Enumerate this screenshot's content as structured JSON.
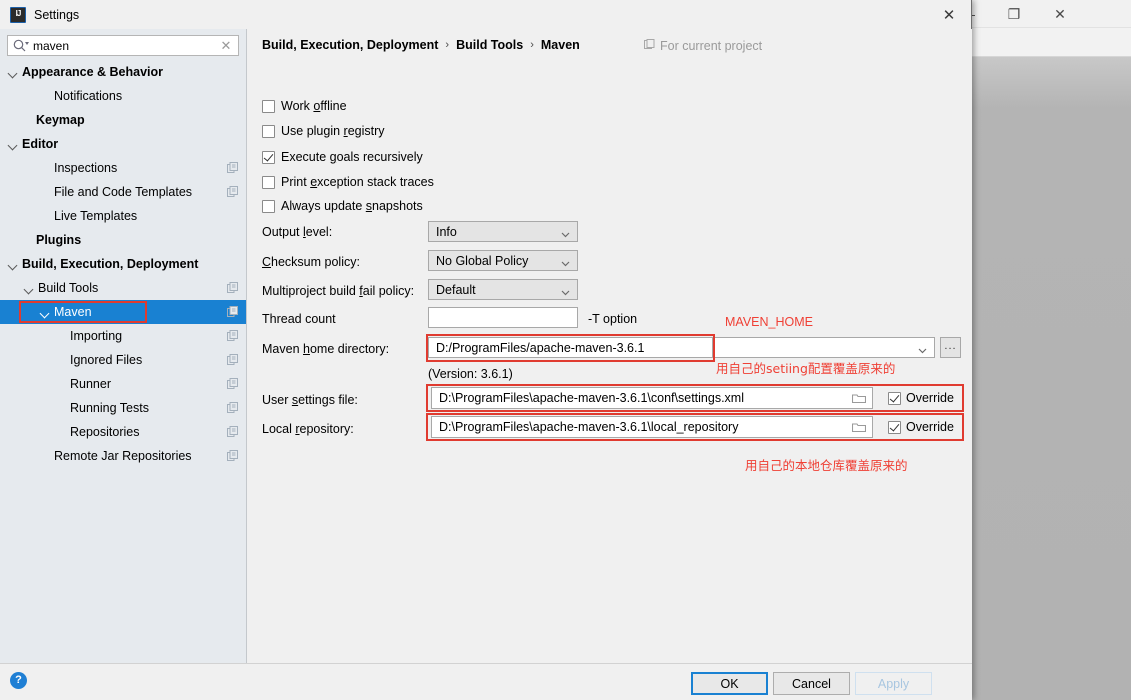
{
  "background_window": {
    "minimize_label": "—",
    "maximize_label": "❐",
    "close_label": "✕",
    "toolbar_icons": [
      "run-with-coverage-icon",
      "profile-icon",
      "dropdown-caret-icon",
      "stop-icon",
      "project-structure-icon",
      "run-configurations-icon"
    ]
  },
  "dialog": {
    "title": "Settings",
    "app_icon": "intellij-idea-icon",
    "close_label": "✕"
  },
  "search": {
    "value": "maven",
    "placeholder": "",
    "icon": "search-icon",
    "clear_label": "✕"
  },
  "sidebar": {
    "items": [
      {
        "label": "Appearance & Behavior",
        "indent": 8,
        "bold": true,
        "arrow": true,
        "copy": false,
        "selected": false
      },
      {
        "label": "Notifications",
        "indent": 40,
        "bold": false,
        "arrow": false,
        "copy": false,
        "selected": false
      },
      {
        "label": "Keymap",
        "indent": 22,
        "bold": true,
        "arrow": false,
        "copy": false,
        "selected": false
      },
      {
        "label": "Editor",
        "indent": 8,
        "bold": true,
        "arrow": true,
        "copy": false,
        "selected": false
      },
      {
        "label": "Inspections",
        "indent": 40,
        "bold": false,
        "arrow": false,
        "copy": true,
        "selected": false
      },
      {
        "label": "File and Code Templates",
        "indent": 40,
        "bold": false,
        "arrow": false,
        "copy": true,
        "selected": false
      },
      {
        "label": "Live Templates",
        "indent": 40,
        "bold": false,
        "arrow": false,
        "copy": false,
        "selected": false
      },
      {
        "label": "Plugins",
        "indent": 22,
        "bold": true,
        "arrow": false,
        "copy": false,
        "selected": false
      },
      {
        "label": "Build, Execution, Deployment",
        "indent": 8,
        "bold": true,
        "arrow": true,
        "copy": false,
        "selected": false
      },
      {
        "label": "Build Tools",
        "indent": 24,
        "bold": false,
        "arrow": true,
        "copy": true,
        "selected": false
      },
      {
        "label": "Maven",
        "indent": 40,
        "bold": false,
        "arrow": true,
        "copy": true,
        "selected": true
      },
      {
        "label": "Importing",
        "indent": 56,
        "bold": false,
        "arrow": false,
        "copy": true,
        "selected": false
      },
      {
        "label": "Ignored Files",
        "indent": 56,
        "bold": false,
        "arrow": false,
        "copy": true,
        "selected": false
      },
      {
        "label": "Runner",
        "indent": 56,
        "bold": false,
        "arrow": false,
        "copy": true,
        "selected": false
      },
      {
        "label": "Running Tests",
        "indent": 56,
        "bold": false,
        "arrow": false,
        "copy": true,
        "selected": false
      },
      {
        "label": "Repositories",
        "indent": 56,
        "bold": false,
        "arrow": false,
        "copy": true,
        "selected": false
      },
      {
        "label": "Remote Jar Repositories",
        "indent": 40,
        "bold": false,
        "arrow": false,
        "copy": true,
        "selected": false
      }
    ]
  },
  "main": {
    "breadcrumb": {
      "part1": "Build, Execution, Deployment",
      "sep1": "›",
      "part2": "Build Tools",
      "sep2": "›",
      "part3": "Maven"
    },
    "for_current_project": "For current project",
    "checkboxes": [
      {
        "label_pre": "Work ",
        "mnemonic": "o",
        "label_post": "ffline",
        "checked": false
      },
      {
        "label_pre": "Use plugin ",
        "mnemonic": "r",
        "label_post": "egistry",
        "checked": false
      },
      {
        "label_pre": "Execute ",
        "mnemonic": "g",
        "label_post": "oals recursively",
        "checked": true
      },
      {
        "label_pre": "Print ",
        "mnemonic": "e",
        "label_post": "xception stack traces",
        "checked": false
      },
      {
        "label_pre": "Always update ",
        "mnemonic": "s",
        "label_post": "napshots",
        "checked": false
      }
    ],
    "output_level": {
      "label_pre": "Output ",
      "mnemonic": "l",
      "label_post": "evel:",
      "value": "Info"
    },
    "checksum_policy": {
      "label_pre": "",
      "mnemonic": "C",
      "label_post": "hecksum policy:",
      "value": "No Global Policy"
    },
    "multiproject_policy": {
      "label_pre": "Multiproject build ",
      "mnemonic": "f",
      "label_post": "ail policy:",
      "value": "Default"
    },
    "thread_count": {
      "label": "Thread count",
      "value": "",
      "suffix": "-T option"
    },
    "maven_home": {
      "label_pre": "Maven ",
      "mnemonic": "h",
      "label_post": "ome directory:",
      "value": "D:/ProgramFiles/apache-maven-3.6.1",
      "version_note": "(Version: 3.6.1)",
      "combo_value": "",
      "browse_label": "..."
    },
    "user_settings": {
      "label_pre": "User ",
      "mnemonic": "s",
      "label_post": "ettings file:",
      "value": "D:\\ProgramFiles\\apache-maven-3.6.1\\conf\\settings.xml",
      "override_label": "Override",
      "override_checked": true
    },
    "local_repository": {
      "label_pre": "Local ",
      "mnemonic": "r",
      "label_post": "epository:",
      "value": "D:\\ProgramFiles\\apache-maven-3.6.1\\local_repository",
      "override_label": "Override",
      "override_checked": true
    },
    "annotations": [
      {
        "text": "MAVEN_HOME"
      },
      {
        "text": "用自己的setiing配置覆盖原来的"
      },
      {
        "text": "用自己的本地仓库覆盖原来的"
      }
    ],
    "annotation_color": "#ef4035"
  },
  "footer": {
    "help_label": "?",
    "ok_label": "OK",
    "cancel_label": "Cancel",
    "apply_label": "Apply"
  }
}
